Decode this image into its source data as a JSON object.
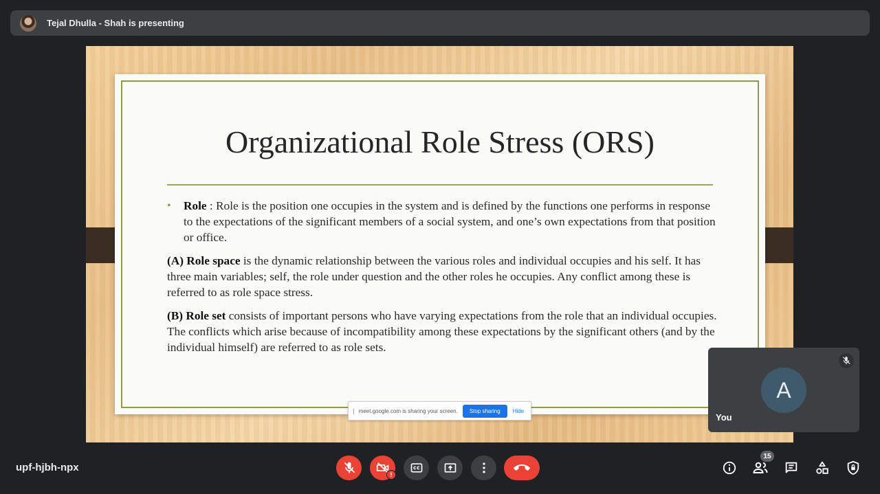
{
  "header": {
    "presenter_text": "Tejal Dhulla - Shah is presenting"
  },
  "slide": {
    "title": "Organizational Role Stress (ORS)",
    "bullet_term": "Role",
    "bullet_text": " : Role is the position one occupies in the system and is defined by the functions one performs in response to the expectations of the significant members of a social system, and one’s own expectations from that position or office.",
    "para_a_term": "(A) Role space",
    "para_a_text": " is the dynamic relationship between the various roles and individual occupies and his self. It has three main variables; self, the role under question and the other roles he occupies. Any conflict among these is referred to as role space stress.",
    "para_b_term": "(B) Role set",
    "para_b_text": " consists of important persons who have varying expectations from the role that an individual occupies. The conflicts which arise because of incompatibility among these expectations by the significant others (and by the individual himself) are referred to as role sets."
  },
  "share_banner": {
    "message": "meet.google.com is sharing your screen.",
    "stop_label": "Stop sharing",
    "hide_label": "Hide"
  },
  "self_tile": {
    "initial": "A",
    "name": "You"
  },
  "footer": {
    "meeting_code": "upf-hjbh-npx",
    "people_count": "15",
    "camera_alert": "!"
  },
  "icons": {
    "mic": "mic-off-icon",
    "camera": "videocam-off-icon",
    "captions": "closed-captions-icon",
    "present": "present-screen-icon",
    "more": "more-vert-icon",
    "end": "call-end-icon",
    "info": "info-icon",
    "people": "people-icon",
    "chat": "chat-icon",
    "activities": "activities-icon",
    "host": "host-controls-icon"
  },
  "colors": {
    "background": "#202124",
    "danger": "#ea4335",
    "button": "#3c4043",
    "accent": "#1a73e8"
  }
}
